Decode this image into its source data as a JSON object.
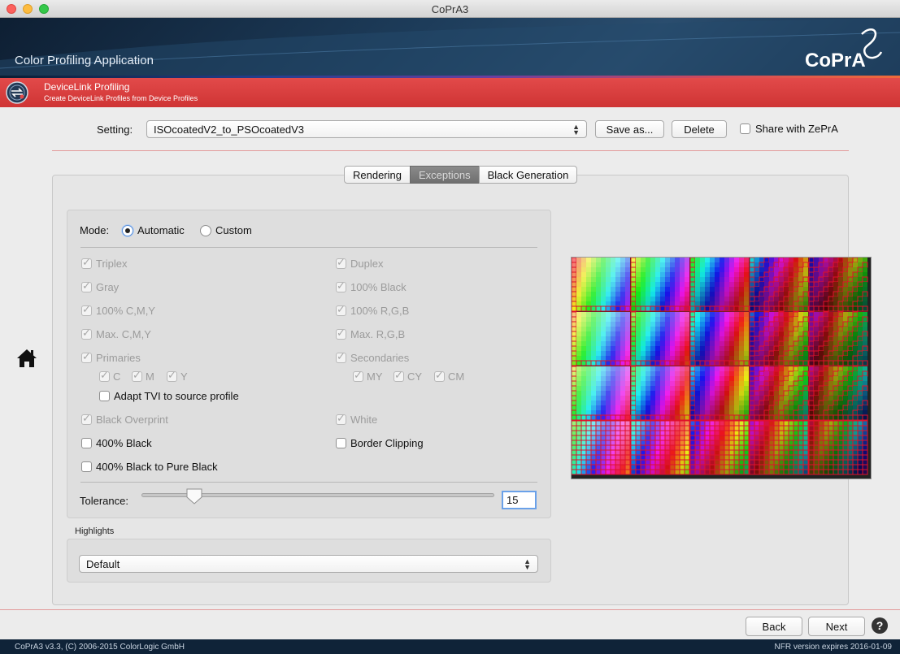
{
  "window": {
    "title": "CoPrA3"
  },
  "banner": {
    "app_title": "Color Profiling Application",
    "logo_text": "CoPrA"
  },
  "section": {
    "title": "DeviceLink Profiling",
    "subtitle": "Create DeviceLink Profiles from Device Profiles"
  },
  "setting": {
    "label": "Setting:",
    "value": "ISOcoatedV2_to_PSOcoatedV3",
    "save_as_label": "Save as...",
    "delete_label": "Delete",
    "share_label": "Share with ZePrA",
    "share_checked": false
  },
  "tabs": [
    {
      "label": "Rendering",
      "active": false
    },
    {
      "label": "Exceptions",
      "active": true
    },
    {
      "label": "Black Generation",
      "active": false
    }
  ],
  "mode": {
    "label": "Mode:",
    "automatic_label": "Automatic",
    "custom_label": "Custom",
    "selected": "Automatic"
  },
  "options": {
    "triplex": "Triplex",
    "duplex": "Duplex",
    "gray": "Gray",
    "black100": "100% Black",
    "cmy100": "100% C,M,Y",
    "rgb100": "100% R,G,B",
    "max_cmy": "Max. C,M,Y",
    "max_rgb": "Max. R,G,B",
    "primaries": "Primaries",
    "secondaries": "Secondaries",
    "c": "C",
    "m": "M",
    "y": "Y",
    "my": "MY",
    "cy": "CY",
    "cm": "CM",
    "adapt_tvi": "Adapt TVI to source profile",
    "black_overprint": "Black Overprint",
    "white": "White",
    "black400": "400% Black",
    "border_clipping": "Border Clipping",
    "black400_pure": "400% Black to Pure Black"
  },
  "tolerance": {
    "label": "Tolerance:",
    "value": "15",
    "level": 15,
    "max": 100
  },
  "highlights": {
    "label": "Highlights",
    "value": "Default"
  },
  "navigation": {
    "back_label": "Back",
    "next_label": "Next",
    "help_label": "?"
  },
  "status": {
    "left": "CoPrA3 v3.3, (C) 2006-2015 ColorLogic GmbH",
    "right": "NFR version expires 2016-01-09"
  },
  "colors": {
    "section_bar": "#d83c3c",
    "banner": "#1d3c5a",
    "active_tab": "#7b7b7b",
    "focus_blue": "#6aa1e9"
  }
}
